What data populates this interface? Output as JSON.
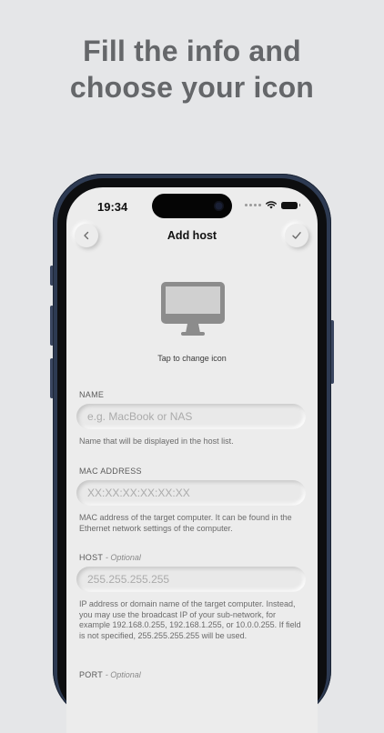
{
  "headline": {
    "line1": "Fill the info and",
    "line2": "choose your icon"
  },
  "status_bar": {
    "time": "19:34"
  },
  "nav": {
    "title": "Add host"
  },
  "icon_picker": {
    "icon": "imac-icon",
    "hint": "Tap to change icon"
  },
  "fields": {
    "name": {
      "label": "NAME",
      "placeholder": "e.g. MacBook or NAS",
      "help": "Name that will be displayed in the host list."
    },
    "mac": {
      "label": "MAC ADDRESS",
      "placeholder": "XX:XX:XX:XX:XX:XX",
      "help": "MAC address of the target computer. It can be found in the Ethernet network settings of the computer."
    },
    "host": {
      "label": "HOST",
      "optional": "- Optional",
      "placeholder": "255.255.255.255",
      "help": "IP address or domain name of the target computer. Instead, you may use the broadcast IP of your sub-network, for example 192.168.0.255, 192.168.1.255, or 10.0.0.255. If field is not specified, 255.255.255.255 will be used."
    },
    "port": {
      "label": "PORT",
      "optional": "- Optional"
    }
  },
  "colors": {
    "background": "#e5e6e8",
    "screen": "#ececec",
    "phone_frame": "#2d3a52",
    "icon_gray": "#8c8c8c"
  }
}
